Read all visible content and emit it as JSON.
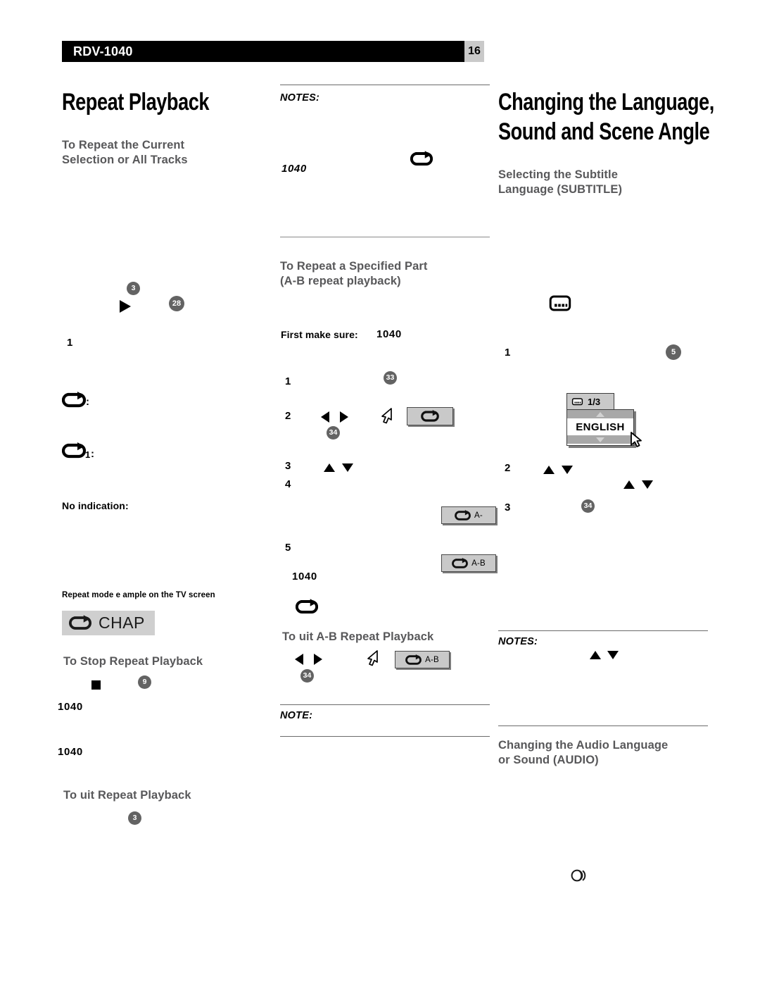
{
  "header": {
    "model": "RDV-1040",
    "page_number": "16"
  },
  "left_column": {
    "title": "Repeat Playback",
    "section_heading": "To  Repeat the Current\nSelection or All Tracks",
    "heading_line1": "To  Repeat the Current",
    "heading_line2": "Selection or All Tracks",
    "badge_play": "3",
    "badge_repeat": "28",
    "step1": "1",
    "indicator_all": ":",
    "indicator_one_number": "1",
    "indicator_one_colon": ":",
    "no_indication": "No indication:",
    "tv_caption": "Repeat mode e  ample on the TV screen",
    "osd_chap_label": "CHAP",
    "stop_heading": "To  Stop Repeat Playback",
    "badge_stop": "9",
    "model_a": "1040",
    "model_b": "1040",
    "exit_heading": "To    uit Repeat Playback",
    "badge_exit": "3"
  },
  "middle_column": {
    "notes_label": "NOTES:",
    "model_note": "1040",
    "ab_heading_line1": "To  Repeat a Specified Part",
    "ab_heading_line2": "(A-B repeat playback)",
    "first_make_sure": "First make sure:",
    "first_make_sure_model": "1040",
    "step1": "1",
    "badge_step1": "33",
    "step2": "2",
    "badge_step2": "34",
    "step3": "3",
    "step4": "4",
    "key_a_label": "A-",
    "step5": "5",
    "key_ab_label": "A-B",
    "model_ab": "1040",
    "exit_ab_heading": "To    uit A-B Repeat Playback",
    "badge_exit_ab": "34",
    "key_ab_exit_label": "A-B",
    "note_label": "NOTE:"
  },
  "right_column": {
    "title_line1": "Changing the Language,",
    "title_line2": "Sound and Scene Angle",
    "subtitle_heading_line1": "Selecting the Subtitle",
    "subtitle_heading_line2": "Language (SUBTITLE)",
    "step1": "1",
    "badge_step1": "5",
    "osd_page_indicator": "1/3",
    "osd_language": "ENGLISH",
    "step2": "2",
    "step3": "3",
    "badge_step3": "34",
    "notes_label": "NOTES:",
    "audio_heading_line1": "Changing the Audio Language",
    "audio_heading_line2": "or Sound (AUDIO)"
  },
  "colors": {
    "header_bar": "#000000",
    "page_badge_bg": "#c9c9c9",
    "section_heading": "#58585a",
    "ref_badge": "#636363",
    "key_button": "#c9c9c9",
    "osd_highlight": "#cfcfcf",
    "osd_arrow_row": "#a8a8a8",
    "rule": "#6b6b6b"
  },
  "icons": {
    "repeat": "repeat-loop-icon",
    "play": "play-triangle-icon",
    "stop": "stop-square-icon",
    "cursor": "mouse-cursor-icon",
    "subtitle": "subtitle-screen-icon",
    "audio": "audio-waves-icon"
  }
}
